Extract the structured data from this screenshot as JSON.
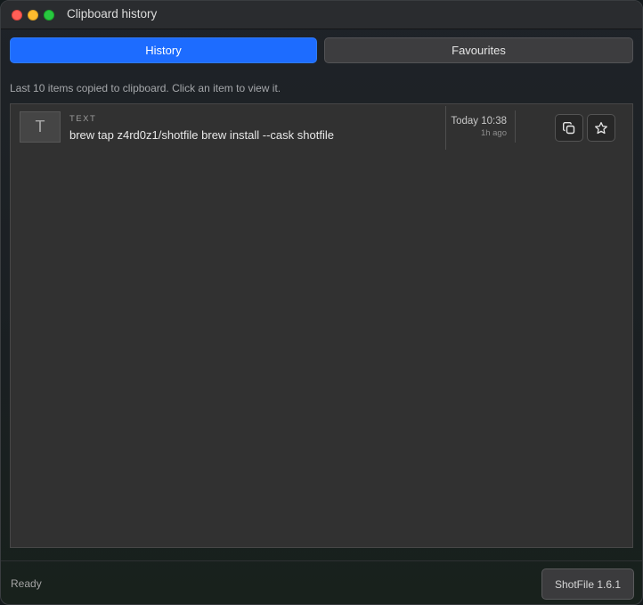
{
  "window": {
    "title": "Clipboard history"
  },
  "tabs": [
    {
      "label": "History",
      "active": true
    },
    {
      "label": "Favourites",
      "active": false
    }
  ],
  "hint": "Last 10 items copied to clipboard. Click an item to view it.",
  "items": [
    {
      "type_initial": "T",
      "type_label": "TEXT",
      "text": "brew tap z4rd0z1/shotfile brew install --cask shotfile",
      "time": "Today 10:38",
      "ago": "1h ago",
      "icons": {
        "copy": "copy-icon",
        "favourite": "star-icon"
      }
    }
  ],
  "status": {
    "text": "Ready",
    "version": "ShotFile 1.6.1"
  },
  "colors": {
    "accent": "#1d6cff",
    "close": "#fe5f57",
    "minimize": "#febc2e",
    "maximize": "#28c840"
  }
}
